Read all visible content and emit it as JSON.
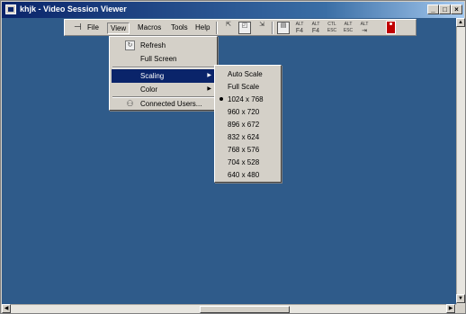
{
  "window": {
    "title": "khjk - Video Session Viewer",
    "controls": {
      "minimize": "_",
      "restore": "□",
      "close": "×"
    }
  },
  "toolbar": {
    "menus": [
      "File",
      "View",
      "Macros",
      "Tools",
      "Help"
    ],
    "active_menu": "View",
    "icons": [
      "pin-icon",
      "pointer-single-icon",
      "refresh-screen-icon",
      "pointer-dual-icon",
      "full-screen-icon",
      "alt-f4-icon",
      "alt-f4-alt-icon",
      "ctrl-esc-icon",
      "alt-esc-icon",
      "alt-tab-icon",
      "connected-users-icon"
    ],
    "icon_labels": {
      "alt_f4_a": [
        "ALT",
        "F4"
      ],
      "alt_f4_b": [
        "ALT",
        "F4"
      ],
      "ctrl_esc": [
        "CTL",
        "ESC"
      ],
      "alt_esc": [
        "ALT",
        "ESC"
      ],
      "alt_tab": [
        "ALT",
        "⇥"
      ]
    }
  },
  "view_menu": {
    "items": [
      {
        "label": "Refresh",
        "icon": "refresh-icon"
      },
      {
        "label": "Full Screen"
      },
      {
        "label": "Scaling",
        "submenu": true,
        "highlighted": true
      },
      {
        "label": "Color",
        "submenu": true
      },
      {
        "label": "Connected Users...",
        "icon": "users-icon"
      }
    ],
    "submenu_arrow": "▶"
  },
  "scaling_menu": {
    "items": [
      {
        "label": "Auto Scale"
      },
      {
        "label": "Full Scale"
      },
      {
        "label": "1024 x 768",
        "selected": true
      },
      {
        "label": "960 x 720"
      },
      {
        "label": "896 x 672"
      },
      {
        "label": "832 x 624"
      },
      {
        "label": "768 x 576"
      },
      {
        "label": "704 x 528"
      },
      {
        "label": "640 x 480"
      }
    ]
  },
  "colors": {
    "desktop": "#2f5b8a",
    "menu_highlight": "#0a246a",
    "title_bar": "#0a246a"
  }
}
